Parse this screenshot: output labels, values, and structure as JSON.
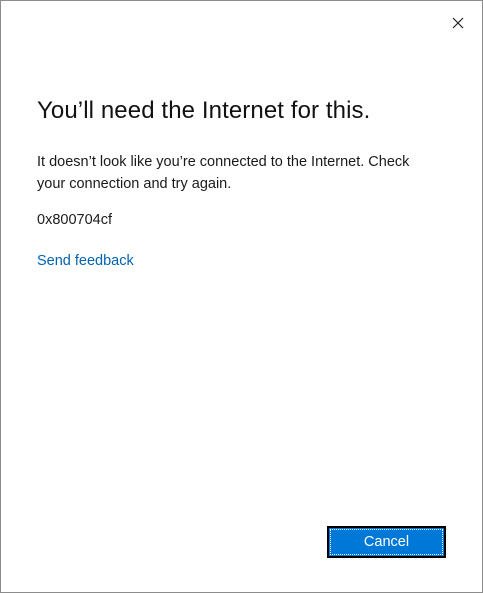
{
  "dialog": {
    "title": "You’ll need the Internet for this.",
    "message": "It doesn’t look like you’re connected to the Internet. Check your connection and try again.",
    "error_code": "0x800704cf",
    "feedback_link": "Send feedback",
    "close_icon": "close-icon",
    "cancel_label": "Cancel"
  },
  "colors": {
    "accent": "#0078d7",
    "link": "#0063b1",
    "text": "#1a1a1a",
    "background": "#ffffff"
  }
}
